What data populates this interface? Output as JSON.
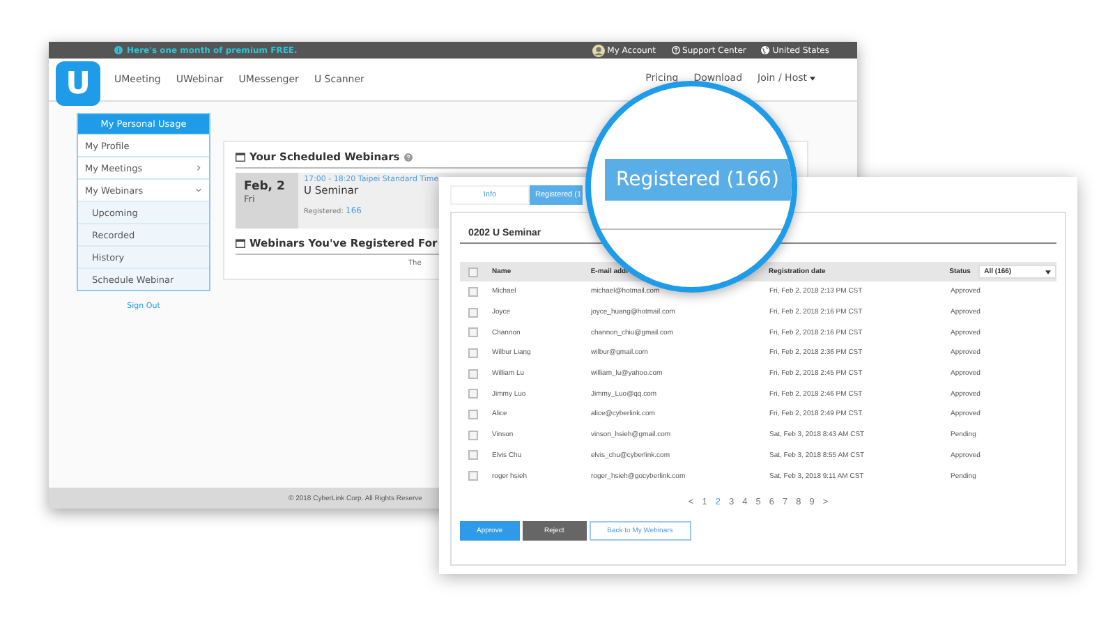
{
  "promo_bar": {
    "message": "Here's one month of premium FREE.",
    "links": [
      {
        "kind": "account",
        "label": "My Account"
      },
      {
        "kind": "support",
        "label": "Support Center"
      },
      {
        "kind": "region",
        "label": "United States"
      }
    ]
  },
  "logo": {
    "text": "U"
  },
  "nav": {
    "items": [
      "UMeeting",
      "UWebinar",
      "UMessenger",
      "U Scanner"
    ],
    "right_items": [
      {
        "label": "Pricing",
        "dropdown": false
      },
      {
        "label": "Download",
        "dropdown": false
      },
      {
        "label": "Join / Host",
        "dropdown": true
      }
    ]
  },
  "sidebar": {
    "title": "My Personal Usage",
    "items": [
      {
        "label": "My Profile",
        "kind": "link"
      },
      {
        "label": "My Meetings",
        "kind": "group",
        "expanded": false
      },
      {
        "label": "My Webinars",
        "kind": "group",
        "expanded": true,
        "children": [
          {
            "label": "Upcoming"
          },
          {
            "label": "Recorded"
          },
          {
            "label": "History"
          },
          {
            "label": "Schedule Webinar"
          }
        ]
      }
    ],
    "sign_out": "Sign Out"
  },
  "scheduled": {
    "title": "Your Scheduled Webinars",
    "webinar": {
      "date": "Feb, 2",
      "weekday": "Fri",
      "time": "17:00 - 18:20 Taipei Standard Time",
      "name": "U Seminar",
      "registered_label": "Registered:",
      "registered_count": "166"
    }
  },
  "registered_for": {
    "title": "Webinars You've Registered For",
    "note": "The"
  },
  "footer": "© 2018 CyberLink Corp. All Rights Reserve",
  "dialog": {
    "tabs": [
      {
        "label": "Info",
        "selected": false
      },
      {
        "label": "Registered (1",
        "selected": true
      }
    ],
    "title": "0202 U Seminar",
    "table": {
      "header_checked": false,
      "columns": [
        "Name",
        "E-mail addr",
        "Registration date",
        "Status"
      ],
      "filter": "All (166)",
      "rows": [
        {
          "name": "Michael",
          "email": "michael@hotmail.com",
          "date": "Fri, Feb 2, 2018 2:13 PM CST",
          "status": "Approved",
          "checked": false
        },
        {
          "name": "Joyce",
          "email": "joyce_huang@hotmail.com",
          "date": "Fri, Feb 2, 2018 2:16 PM CST",
          "status": "Approved",
          "checked": false
        },
        {
          "name": "Channon",
          "email": "channon_chiu@gmail.com",
          "date": "Fri, Feb 2, 2018 2:16 PM CST",
          "status": "Approved",
          "checked": false
        },
        {
          "name": "Wilbur Liang",
          "email": "wilbur@gmail.com",
          "date": "Fri, Feb 2, 2018 2:36 PM CST",
          "status": "Approved",
          "checked": false
        },
        {
          "name": "William Lu",
          "email": "william_lu@yahoo.com",
          "date": "Fri, Feb 2, 2018 2:45 PM CST",
          "status": "Approved",
          "checked": false
        },
        {
          "name": "Jimmy Luo",
          "email": "Jimmy_Luo@qq.com",
          "date": "Fri, Feb 2, 2018 2:46 PM CST",
          "status": "Approved",
          "checked": false
        },
        {
          "name": "Alice",
          "email": "alice@cyberlink.com",
          "date": "Fri, Feb 2, 2018 2:49 PM CST",
          "status": "Approved",
          "checked": false
        },
        {
          "name": "Vinson",
          "email": "vinson_hsieh@gmail.com",
          "date": "Sat, Feb 3, 2018 8:43 AM CST",
          "status": "Pending",
          "checked": false
        },
        {
          "name": "Elvis Chu",
          "email": "elvis_chu@cyberlink.com",
          "date": "Sat, Feb 3, 2018 8:55 AM CST",
          "status": "Approved",
          "checked": false
        },
        {
          "name": "roger hsieh",
          "email": "roger_hsieh@gocyberlink.com",
          "date": "Sat, Feb 3, 2018 9:11 AM CST",
          "status": "Pending",
          "checked": false
        }
      ]
    },
    "pagination": [
      {
        "label": "<",
        "selected": false
      },
      {
        "label": "1",
        "selected": false
      },
      {
        "label": "2",
        "selected": true
      },
      {
        "label": "3",
        "selected": false
      },
      {
        "label": "4",
        "selected": false
      },
      {
        "label": "5",
        "selected": false
      },
      {
        "label": "6",
        "selected": false
      },
      {
        "label": "7",
        "selected": false
      },
      {
        "label": "8",
        "selected": false
      },
      {
        "label": "9",
        "selected": false
      },
      {
        "label": ">",
        "selected": false
      }
    ],
    "buttons": [
      {
        "kind": "primary",
        "label": "Approve"
      },
      {
        "kind": "secondary",
        "label": "Reject"
      },
      {
        "kind": "outline",
        "label": "Back to My Webinars"
      }
    ]
  },
  "magnifier": {
    "tab": {
      "label": "Registered (166)",
      "selected": true
    }
  }
}
